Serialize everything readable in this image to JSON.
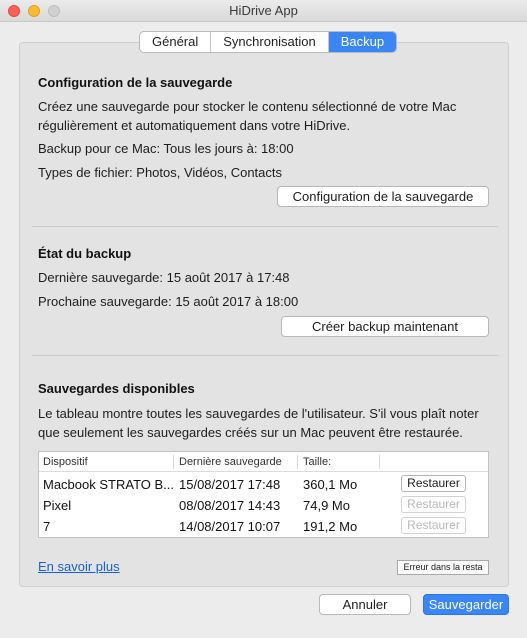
{
  "window": {
    "title": "HiDrive App"
  },
  "tabs": [
    {
      "label": "Général"
    },
    {
      "label": "Synchronisation"
    },
    {
      "label": "Backup"
    }
  ],
  "config": {
    "title": "Configuration de la sauvegarde",
    "description_line1": "Créez une sauvegarde pour stocker le contenu sélectionné de votre Mac",
    "description_line2": "régulièrement et automatiquement dans votre HiDrive.",
    "backup_schedule": "Backup pour ce Mac: Tous les jours à: 18:00",
    "file_types": "Types de fichier: Photos, Vidéos, Contacts",
    "button_label": "Configuration de la sauvegarde"
  },
  "status": {
    "title": "État du backup",
    "last_backup": "Dernière sauvegarde: 15 août 2017 à 17:48",
    "next_backup": "Prochaine sauvegarde: 15 août 2017 à 18:00",
    "button_label": "Créer backup maintenant"
  },
  "available": {
    "title": "Sauvegardes disponibles",
    "description_line1": "Le tableau montre toutes les sauvegardes de l'utilisateur. S'il vous plaît noter",
    "description_line2": "que seulement les sauvegardes créés sur un Mac peuvent être restaurée.",
    "columns": [
      "Dispositif",
      "Dernière sauvegarde",
      "Taille:"
    ],
    "rows": [
      {
        "device": "Macbook STRATO B...",
        "date": "15/08/2017 17:48",
        "size": "360,1 Mo",
        "action": "Restaurer",
        "enabled": true
      },
      {
        "device": "Pixel",
        "date": "08/08/2017 14:43",
        "size": "74,9 Mo",
        "action": "Restaurer",
        "enabled": false
      },
      {
        "device": "7",
        "date": "14/08/2017 10:07",
        "size": "191,2 Mo",
        "action": "Restaurer",
        "enabled": false
      }
    ]
  },
  "footer": {
    "learn_more": "En savoir plus",
    "error_button": "Erreur dans la resta",
    "cancel": "Annuler",
    "save": "Sauvegarder"
  }
}
